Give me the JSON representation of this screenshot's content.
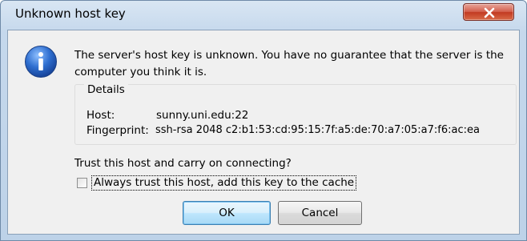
{
  "window": {
    "title": "Unknown host key",
    "close_label": "X"
  },
  "message": {
    "line1": "The server's host key is unknown. You have no guarantee that the server is the",
    "line2": "computer you think it is."
  },
  "details": {
    "legend": "Details",
    "host_label": "Host:",
    "host_value": "sunny.uni.edu:22",
    "fingerprint_label": "Fingerprint:",
    "fingerprint_value": "ssh-rsa 2048 c2:b1:53:cd:95:15:7f:a5:de:70:a7:05:a7:f6:ac:ea"
  },
  "prompt": {
    "question": "Trust this host and carry on connecting?",
    "checkbox_label": "Always trust this host, add this key to the cache",
    "checkbox_checked": false
  },
  "buttons": {
    "ok": "OK",
    "cancel": "Cancel"
  },
  "icons": {
    "dialog_icon": "information-icon",
    "close_icon": "close-icon"
  },
  "colors": {
    "info_icon_blue": "#2f6fd0",
    "close_button_red": "#c9452e",
    "title_frame": "#c5d8ec"
  }
}
